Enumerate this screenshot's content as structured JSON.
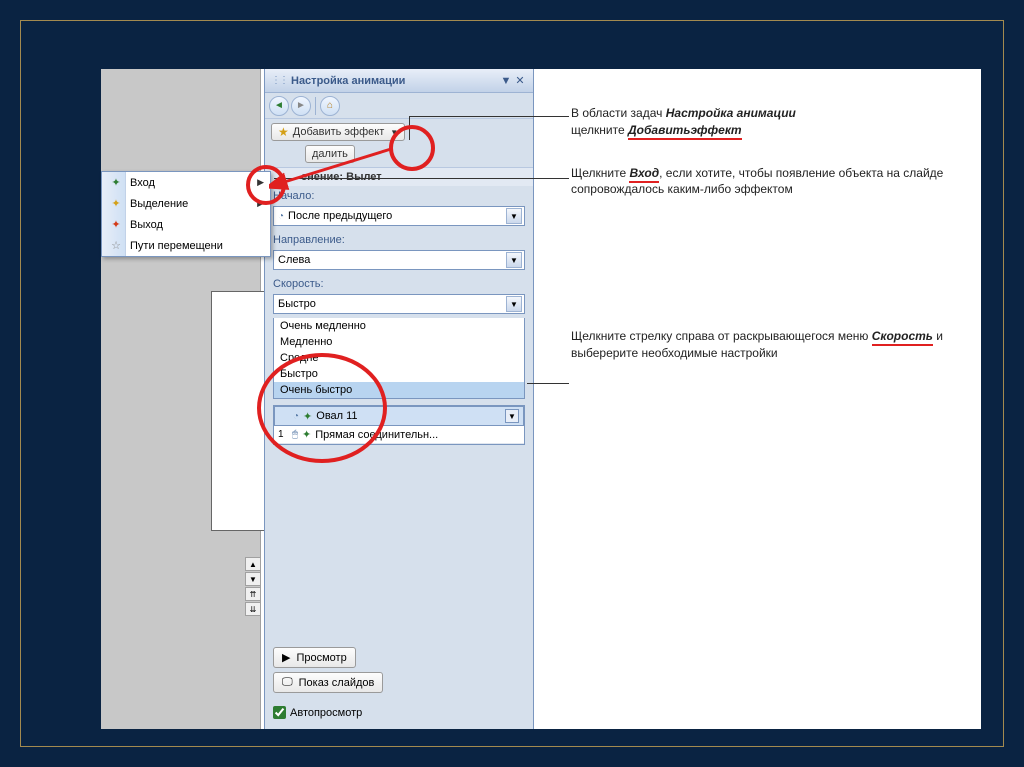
{
  "taskpane": {
    "title": "Настройка анимации",
    "add_effect": "Добавить эффект",
    "remove": "далить",
    "change_header": "енение: Вылет",
    "start_label": "Начало:",
    "start_value": "После предыдущего",
    "direction_label": "Направление:",
    "direction_value": "Слева",
    "speed_label": "Скорость:",
    "speed_value": "Быстро",
    "speed_options": [
      "Очень медленно",
      "Медленно",
      "Средне",
      "Быстро",
      "Очень быстро"
    ],
    "objects": [
      {
        "name": "Овал 11"
      },
      {
        "name": "Прямая соединительн..."
      }
    ],
    "preview": "Просмотр",
    "slideshow": "Показ слайдов",
    "autopreview": "Автопросмотр"
  },
  "menu": {
    "items": [
      {
        "icon_color": "#2e7d32",
        "label": "Вход",
        "has_sub": true
      },
      {
        "icon_color": "#d4a017",
        "label": "Выделение",
        "has_sub": true
      },
      {
        "icon_color": "#d43a17",
        "label": "Выход",
        "has_sub": false
      },
      {
        "icon_color": "#888",
        "label": "Пути перемещени",
        "has_sub": false
      }
    ]
  },
  "annotations": {
    "a1_pre": "В области задач ",
    "a1_em1": "Настройка анимации",
    "a1_mid": " щелкните ",
    "a1_em2": "Добавитьэффект",
    "a2_pre": "Щелкните ",
    "a2_em": "Вход",
    "a2_post": ", если хотите, чтобы появление объекта на слайде сопровождалось каким-либо эффектом",
    "a3_pre": "Щелкните стрелку справа от раскрывающегося меню ",
    "a3_em": "Скорость",
    "a3_post": " и выберерите необходимые настройки"
  }
}
